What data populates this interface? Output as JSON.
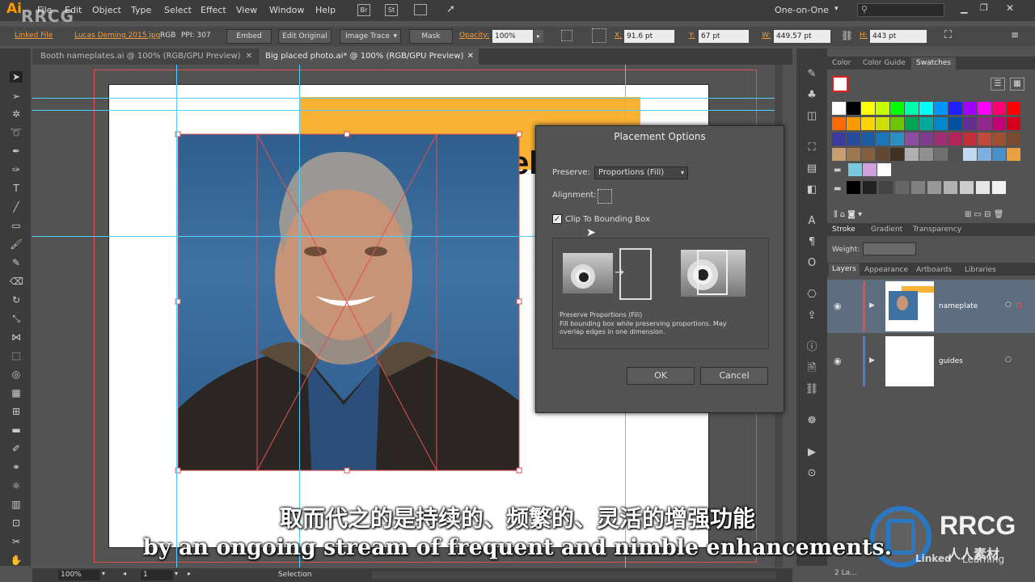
{
  "app": {
    "logo": "Ai",
    "watermark": "RRCG"
  },
  "menu": [
    "File",
    "Edit",
    "Object",
    "Type",
    "Select",
    "Effect",
    "View",
    "Window",
    "Help"
  ],
  "menu_icons": {
    "bridge": "Br",
    "stock": "St"
  },
  "workspace": "One-on-One",
  "control": {
    "linked_file": "Linked File",
    "filename": "Lucas Deming 2015.jpg",
    "color_mode": "RGB",
    "ppi": "PPI: 307",
    "embed": "Embed",
    "edit_original": "Edit Original",
    "image_trace": "Image Trace",
    "mask": "Mask",
    "opacity_label": "Opacity:",
    "opacity": "100%",
    "x_label": "X:",
    "x": "91.6 pt",
    "y_label": "Y:",
    "y": "67 pt",
    "w_label": "W:",
    "w": "449.57 pt",
    "h_label": "H:",
    "h": "443 pt"
  },
  "tabs": [
    "Booth nameplates.ai @ 100% (RGB/GPU Preview)",
    "Big placed photo.ai* @ 100% (RGB/GPU Preview)"
  ],
  "artboard_text": "el",
  "dialog": {
    "title": "Placement Options",
    "preserve_label": "Preserve:",
    "preserve_value": "Proportions (Fill)",
    "alignment_label": "Alignment:",
    "clip_label": "Clip To Bounding Box",
    "clip_checked": true,
    "desc_title": "Preserve Proportions (Fill)",
    "desc_body": "Fill bounding box while preserving proportions. May overlap edges in one dimension.",
    "ok": "OK",
    "cancel": "Cancel"
  },
  "panels": {
    "color_tabs": [
      "Color",
      "Color Guide",
      "Swatches"
    ],
    "stroke_tabs": [
      "Stroke",
      "Gradient",
      "Transparency"
    ],
    "weight_label": "Weight:",
    "layer_tabs": [
      "Layers",
      "Appearance",
      "Artboards",
      "Libraries"
    ],
    "layers": [
      {
        "name": "nameplate",
        "color": "#e05050"
      },
      {
        "name": "guides",
        "color": "#4a7ae0"
      }
    ],
    "layer_count": "2 La..."
  },
  "status": {
    "zoom": "100%",
    "artboard": "1",
    "tool": "Selection"
  },
  "subtitles": {
    "zh": "取而代之的是持续的、频繁的、灵活的增强功能",
    "en": "by an ongoing stream of frequent and nimble enhancements."
  },
  "overlay": {
    "brand": "RRCG",
    "brand_cn": "人人素材",
    "linkedin": "Learning",
    "linkedin_prefix": "Linked"
  },
  "swatch_rows": [
    [
      "#ffffff",
      "#000000",
      "#ffff00",
      "#c8ff00",
      "#00ff00",
      "#00ffaa",
      "#00ffff",
      "#0096ff",
      "#2020ff",
      "#a000ff",
      "#ff00ff",
      "#ff0070",
      "#ff0000"
    ],
    [
      "#ff6a00",
      "#ff9900",
      "#ffd400",
      "#cfe000",
      "#6fc600",
      "#00a651",
      "#00a99d",
      "#0088cc",
      "#0050a0",
      "#662d91",
      "#92278f",
      "#c1007a",
      "#d6001c"
    ],
    [
      "#3a3aa0",
      "#274a9a",
      "#1c5ca3",
      "#1b75bb",
      "#2a8fc4",
      "#8e4d9e",
      "#7d3c8c",
      "#9d2f72",
      "#b2245a",
      "#c22e3a",
      "#bf4a3a",
      "#a05030",
      "#7a4a30"
    ],
    [
      "#c8a070",
      "#a07850",
      "#806040",
      "#604830",
      "#403020",
      "#b0b0b0",
      "#909090",
      "#707070",
      "#505050",
      "#c0d8f0",
      "#7bb0e0",
      "#4a90c8",
      "#e8a040"
    ]
  ],
  "swatch_gray": [
    "#000000",
    "#222222",
    "#444444",
    "#666666",
    "#808080",
    "#999999",
    "#b3b3b3",
    "#cccccc",
    "#e6e6e6",
    "#f2f2f2"
  ],
  "swatch_group": [
    "#7ac8e0",
    "#cfa0e0",
    "#ffffff"
  ]
}
